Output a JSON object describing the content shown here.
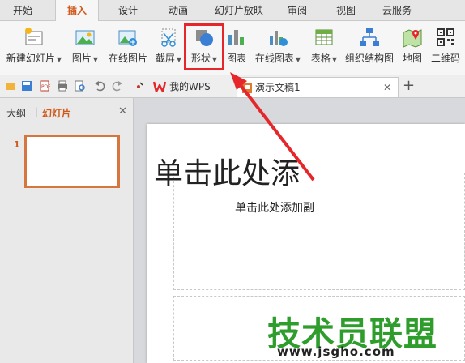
{
  "menu_tabs": [
    "开始",
    "插入",
    "设计",
    "动画",
    "幻灯片放映",
    "审阅",
    "视图",
    "云服务"
  ],
  "active_menu_tab": "插入",
  "ribbon": {
    "new_slide": "新建幻灯片",
    "picture": "图片",
    "online_picture": "在线图片",
    "screenshot": "截屏",
    "shape": "形状",
    "chart": "图表",
    "online_chart": "在线图表",
    "table": "表格",
    "org_chart": "组织结构图",
    "map": "地图",
    "qrcode": "二维码"
  },
  "doc_tabs": {
    "wps": "我的WPS",
    "presentation": "演示文稿1"
  },
  "side_panel": {
    "outline_tab": "大纲",
    "slides_tab": "幻灯片",
    "slide_number": "1"
  },
  "slide": {
    "title_placeholder": "单击此处添",
    "subtitle_placeholder": "单击此处添加副"
  },
  "watermark": {
    "text": "技术员联盟",
    "url": "www.jsgho.com"
  },
  "colors": {
    "accent": "#d05a1b",
    "highlight": "#e5262a",
    "watermark": "#2e9d2c"
  }
}
